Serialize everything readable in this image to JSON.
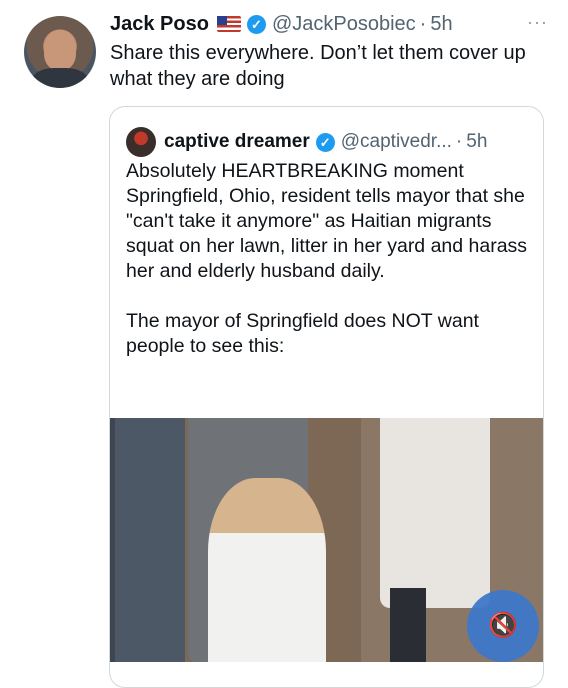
{
  "tweet": {
    "name": "Jack Poso",
    "flag_emoji": "us-flag",
    "handle": "@JackPosobiec",
    "dot": "·",
    "time": "5h",
    "more": "···",
    "text": "Share this everywhere. Don’t let them cover up what they are doing"
  },
  "quote": {
    "name": "captive dreamer",
    "handle": "@captivedr...",
    "dot": "·",
    "time": "5h",
    "text": "Absolutely HEARTBREAKING moment Springfield, Ohio, resident tells mayor that she \"can't take it anymore\" as Haitian migrants squat on her lawn, litter in her yard and harass her and elderly husband daily.\n\nThe mayor of Springfield does NOT want people to see this:",
    "video": {
      "mute_icon": "speaker-muted-icon"
    }
  },
  "colors": {
    "accent": "#1d9bf0",
    "secondary_text": "#536471",
    "border": "#cfd9de"
  }
}
